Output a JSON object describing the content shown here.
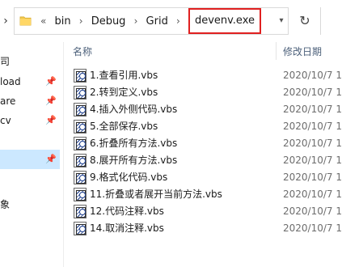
{
  "address": {
    "overflow": "«",
    "crumbs": [
      "bin",
      "Debug",
      "Grid"
    ],
    "current": "devenv.exe",
    "separator": "›"
  },
  "columns": {
    "name": "名称",
    "date": "修改日期"
  },
  "nav": {
    "items": [
      {
        "label": "司",
        "pinned": false,
        "selected": false
      },
      {
        "label": "load",
        "pinned": true,
        "selected": false
      },
      {
        "label": "are",
        "pinned": true,
        "selected": false
      },
      {
        "label": "cv",
        "pinned": true,
        "selected": false
      },
      {
        "label": "",
        "pinned": true,
        "selected": true
      },
      {
        "label": "象",
        "pinned": false,
        "selected": false
      }
    ]
  },
  "files": [
    {
      "name": "1.查看引用.vbs",
      "date": "2020/10/7 1:"
    },
    {
      "name": "2.转到定义.vbs",
      "date": "2020/10/7 1:"
    },
    {
      "name": "4.插入外侧代码.vbs",
      "date": "2020/10/7 1:"
    },
    {
      "name": "5.全部保存.vbs",
      "date": "2020/10/7 1:"
    },
    {
      "name": "6.折叠所有方法.vbs",
      "date": "2020/10/7 1:"
    },
    {
      "name": "8.展开所有方法.vbs",
      "date": "2020/10/7 1:"
    },
    {
      "name": "9.格式化代码.vbs",
      "date": "2020/10/7 1:"
    },
    {
      "name": "11.折叠或者展开当前方法.vbs",
      "date": "2020/10/7 1"
    },
    {
      "name": "12.代码注释.vbs",
      "date": "2020/10/7 1:"
    },
    {
      "name": "14.取消注释.vbs",
      "date": "2020/10/7 1:"
    }
  ],
  "icons": {
    "folder": "folder-icon",
    "refresh": "refresh-icon",
    "pin": "pin-icon",
    "file": "vbs-script-icon"
  }
}
